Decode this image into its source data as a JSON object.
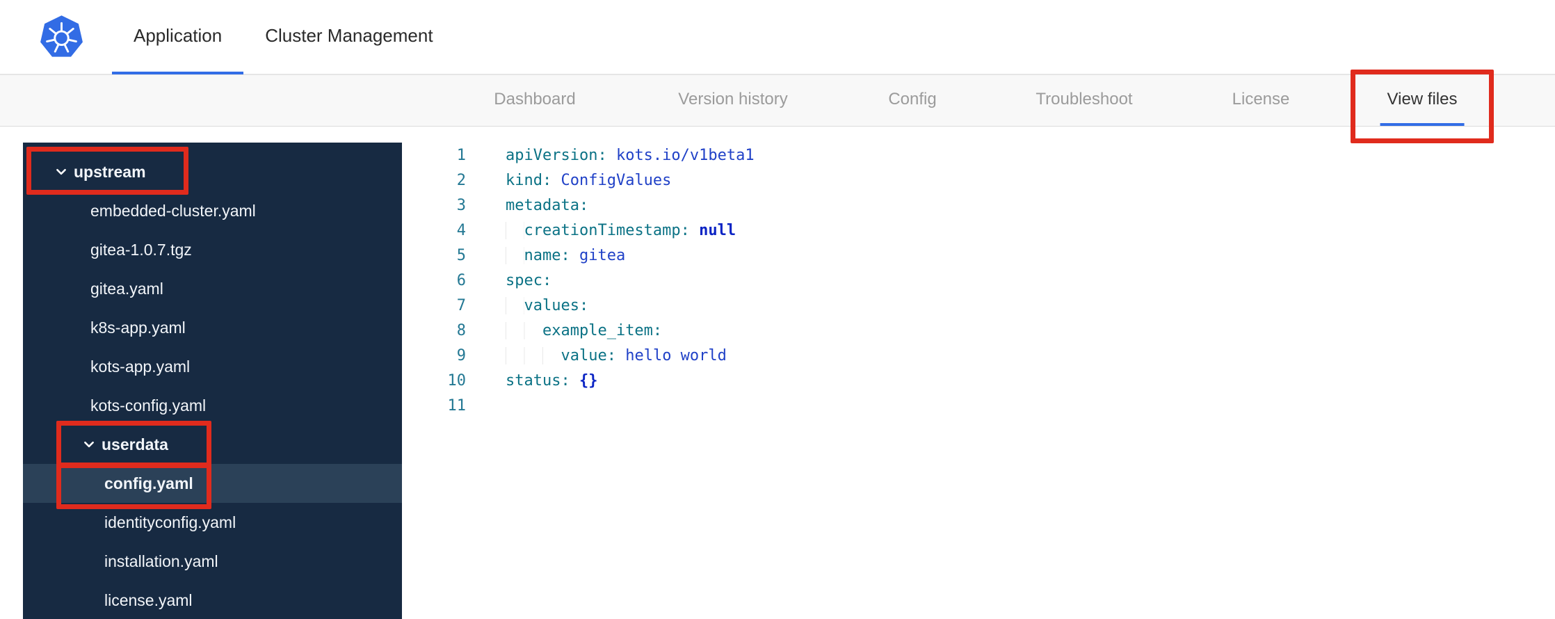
{
  "header": {
    "tabs": [
      {
        "label": "Application",
        "active": true
      },
      {
        "label": "Cluster Management",
        "active": false
      }
    ]
  },
  "subnav": {
    "items": [
      {
        "label": "Dashboard",
        "active": false
      },
      {
        "label": "Version history",
        "active": false
      },
      {
        "label": "Config",
        "active": false
      },
      {
        "label": "Troubleshoot",
        "active": false
      },
      {
        "label": "License",
        "active": false
      },
      {
        "label": "View files",
        "active": true,
        "annotated": true
      }
    ]
  },
  "file_tree": {
    "items": [
      {
        "label": "upstream",
        "type": "folder",
        "level": 0,
        "expanded": true,
        "annotated": true,
        "selected": false
      },
      {
        "label": "embedded-cluster.yaml",
        "type": "file",
        "level": 1,
        "selected": false
      },
      {
        "label": "gitea-1.0.7.tgz",
        "type": "file",
        "level": 1,
        "selected": false
      },
      {
        "label": "gitea.yaml",
        "type": "file",
        "level": 1,
        "selected": false
      },
      {
        "label": "k8s-app.yaml",
        "type": "file",
        "level": 1,
        "selected": false
      },
      {
        "label": "kots-app.yaml",
        "type": "file",
        "level": 1,
        "selected": false
      },
      {
        "label": "kots-config.yaml",
        "type": "file",
        "level": 1,
        "selected": false
      },
      {
        "label": "userdata",
        "type": "folder",
        "level": 1,
        "expanded": true,
        "annotated": true,
        "selected": false
      },
      {
        "label": "config.yaml",
        "type": "file",
        "level": 2,
        "selected": true,
        "annotated": true
      },
      {
        "label": "identityconfig.yaml",
        "type": "file",
        "level": 2,
        "selected": false
      },
      {
        "label": "installation.yaml",
        "type": "file",
        "level": 2,
        "selected": false
      },
      {
        "label": "license.yaml",
        "type": "file",
        "level": 2,
        "selected": false
      }
    ]
  },
  "editor": {
    "lines": [
      {
        "number": 1,
        "tokens": [
          {
            "t": "apiVersion:",
            "c": "key"
          },
          {
            "t": " kots.io/v1beta1",
            "c": "val"
          }
        ]
      },
      {
        "number": 2,
        "tokens": [
          {
            "t": "kind:",
            "c": "key"
          },
          {
            "t": " ConfigValues",
            "c": "val"
          }
        ]
      },
      {
        "number": 3,
        "tokens": [
          {
            "t": "metadata:",
            "c": "key"
          }
        ]
      },
      {
        "number": 4,
        "tokens": [
          {
            "t": "  ",
            "c": "ind"
          },
          {
            "t": "creationTimestamp:",
            "c": "key"
          },
          {
            "t": " null",
            "c": "kw"
          }
        ]
      },
      {
        "number": 5,
        "tokens": [
          {
            "t": "  ",
            "c": "ind"
          },
          {
            "t": "name:",
            "c": "key"
          },
          {
            "t": " gitea",
            "c": "val"
          }
        ]
      },
      {
        "number": 6,
        "tokens": [
          {
            "t": "spec:",
            "c": "key"
          }
        ]
      },
      {
        "number": 7,
        "tokens": [
          {
            "t": "  ",
            "c": "ind"
          },
          {
            "t": "values:",
            "c": "key"
          }
        ]
      },
      {
        "number": 8,
        "tokens": [
          {
            "t": "    ",
            "c": "ind"
          },
          {
            "t": "example_item:",
            "c": "key"
          }
        ]
      },
      {
        "number": 9,
        "tokens": [
          {
            "t": "      ",
            "c": "ind"
          },
          {
            "t": "value:",
            "c": "key"
          },
          {
            "t": " hello world",
            "c": "val"
          }
        ]
      },
      {
        "number": 10,
        "tokens": [
          {
            "t": "status:",
            "c": "key"
          },
          {
            "t": " {}",
            "c": "kw"
          }
        ]
      },
      {
        "number": 11,
        "tokens": []
      }
    ]
  },
  "annotations": [
    "view-files-tab",
    "upstream-folder",
    "userdata-folder",
    "config-yaml-file"
  ],
  "colors": {
    "accent_blue": "#326de6",
    "sidebar_bg": "#172a42",
    "sidebar_selected_bg": "#2b4158",
    "annotation_red": "#e02b1d",
    "code_key": "#0b7285",
    "code_value": "#2041c7",
    "code_keyword": "#0b24c4",
    "line_number": "#237893"
  }
}
